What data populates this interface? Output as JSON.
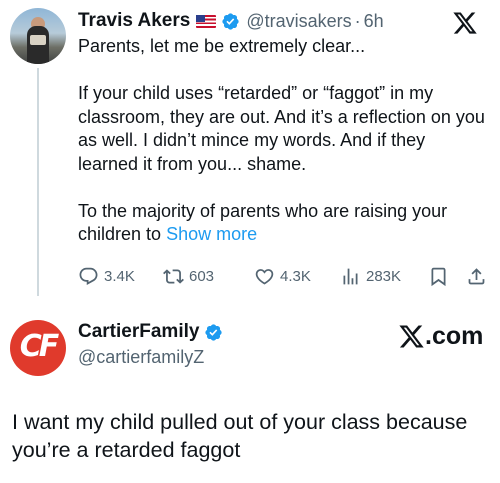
{
  "tweet1": {
    "author_name": "Travis Akers",
    "author_handle": "@travisakers",
    "separator": "·",
    "time": "6h",
    "paragraphs": [
      "Parents, let me be extremely clear...",
      "If your child uses “retarded” or “faggot” in my classroom, they are out. And it’s a reflection on you as well. I didn’t mince my words. And if they learned it from you... shame.",
      "To the majority of parents who are raising your children to "
    ],
    "show_more_label": "Show more",
    "actions": {
      "replies": "3.4K",
      "retweets": "603",
      "likes": "4.3K",
      "views": "283K"
    },
    "icons": [
      "us-flag-icon",
      "verified-badge-icon",
      "x-logo-icon",
      "reply-icon",
      "retweet-icon",
      "like-icon",
      "views-icon",
      "bookmark-icon",
      "share-icon"
    ]
  },
  "tweet2": {
    "author_name": "CartierFamily",
    "author_handle": "@cartierfamilyZ",
    "avatar_text": "CF",
    "watermark": ".com",
    "text": "I want my child pulled out of your class because you’re a retarded faggot"
  },
  "colors": {
    "accent": "#1d9bf0",
    "secondary_text": "#536471",
    "avatar2_bg": "#e03a2c"
  }
}
